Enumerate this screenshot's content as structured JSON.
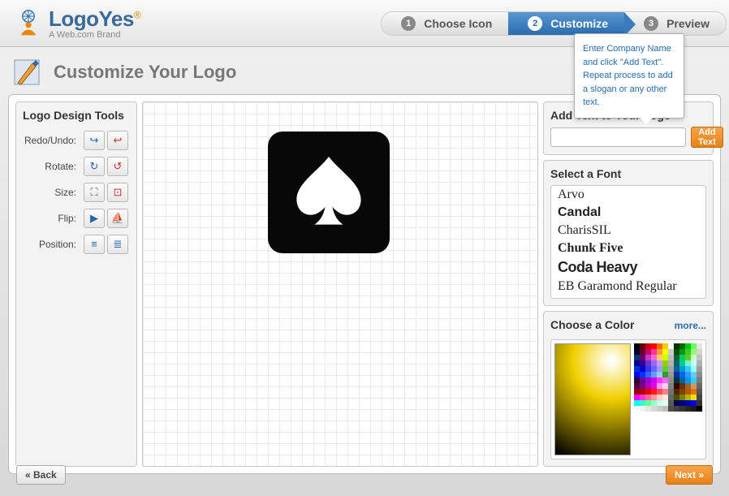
{
  "brand": {
    "name": "LogoYes",
    "reg": "®",
    "tagline": "A Web.com Brand"
  },
  "steps": [
    {
      "num": "1",
      "label": "Choose Icon"
    },
    {
      "num": "2",
      "label": "Customize"
    },
    {
      "num": "3",
      "label": "Preview"
    }
  ],
  "page_title": "Customize Your Logo",
  "tooltip": "Enter Company Name and click \"Add Text\". Repeat process to add a slogan or any other text.",
  "left": {
    "title": "Logo Design Tools",
    "rows": {
      "redo_undo": "Redo/Undo:",
      "rotate": "Rotate:",
      "size": "Size:",
      "flip": "Flip:",
      "position": "Position:"
    }
  },
  "addtext": {
    "title": "Add Text to Your Logo",
    "button": "Add Text",
    "value": ""
  },
  "fonts": {
    "title": "Select a Font",
    "items": [
      "Arvo",
      "Candal",
      "CharisSIL",
      "Chunk Five",
      "Coda Heavy",
      "EB Garamond Regular"
    ]
  },
  "color": {
    "title": "Choose a Color",
    "more": "more..."
  },
  "nav": {
    "back": "« Back",
    "next": "Next »"
  },
  "swatches": [
    "#000000",
    "#660000",
    "#cc0000",
    "#ff0000",
    "#ff6600",
    "#ffcc00",
    "#ffffff",
    "#003300",
    "#006600",
    "#00cc00",
    "#66ff66",
    "#e6e6e6",
    "#000033",
    "#660033",
    "#cc0066",
    "#ff3399",
    "#ff9933",
    "#ffff00",
    "#cccccc",
    "#004d00",
    "#009900",
    "#33cc33",
    "#99ff66",
    "#d4d4d4",
    "#003366",
    "#660066",
    "#cc33cc",
    "#ff66cc",
    "#ffcc66",
    "#ccff00",
    "#bfbfbf",
    "#006633",
    "#00cc66",
    "#66cc00",
    "#ccffcc",
    "#c2c2c2",
    "#000099",
    "#330099",
    "#6633cc",
    "#9966ff",
    "#cc99ff",
    "#99cc00",
    "#b3b3b3",
    "#006666",
    "#00cc99",
    "#66ffcc",
    "#ccffff",
    "#b0b0b0",
    "#0033cc",
    "#0000cc",
    "#3333ff",
    "#6666ff",
    "#9999ff",
    "#66cc33",
    "#a6a6a6",
    "#006699",
    "#0099cc",
    "#33ccff",
    "#99ffff",
    "#9e9e9e",
    "#0000ff",
    "#0033ff",
    "#3366ff",
    "#6699ff",
    "#99ccff",
    "#339933",
    "#999999",
    "#003399",
    "#0066ff",
    "#3399ff",
    "#66ccff",
    "#8c8c8c",
    "#330033",
    "#660099",
    "#9900cc",
    "#cc00ff",
    "#ff33ff",
    "#ff66ff",
    "#8c8c8c",
    "#003333",
    "#006699",
    "#0099ff",
    "#33ccff",
    "#7a7a7a",
    "#4d004d",
    "#800080",
    "#b300b3",
    "#e600e6",
    "#ff99ff",
    "#ffccff",
    "#808080",
    "#330000",
    "#663300",
    "#996633",
    "#cc9966",
    "#686868",
    "#990000",
    "#b30000",
    "#e60000",
    "#ff1a1a",
    "#ff4d4d",
    "#ff8080",
    "#737373",
    "#4d2600",
    "#804000",
    "#b35900",
    "#e67300",
    "#565656",
    "#ff00ff",
    "#ff33cc",
    "#ff6699",
    "#ff9999",
    "#ffcccc",
    "#ffe6e6",
    "#666666",
    "#4d4d00",
    "#808000",
    "#b3b300",
    "#e6e600",
    "#444444",
    "#00ffff",
    "#33ffcc",
    "#66ff99",
    "#99ffcc",
    "#ccffe6",
    "#e6fff2",
    "#595959",
    "#00004d",
    "#000080",
    "#0000b3",
    "#0000e6",
    "#323232",
    "#ffffff",
    "#f2f2f2",
    "#e6e6e6",
    "#d9d9d9",
    "#cccccc",
    "#bfbfbf",
    "#4d4d4d",
    "#404040",
    "#333333",
    "#262626",
    "#1a1a1a",
    "#000000"
  ]
}
